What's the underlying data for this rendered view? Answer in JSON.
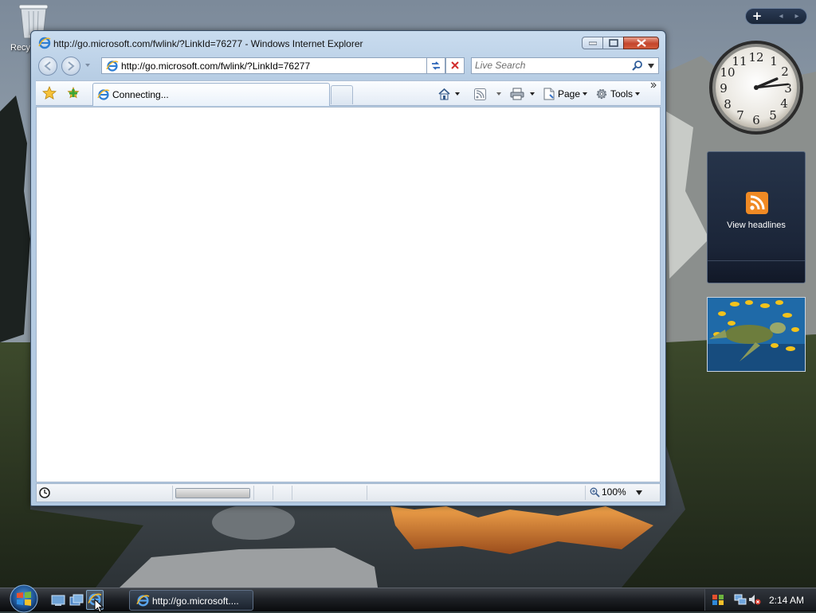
{
  "desktop": {
    "recycle_bin_label": "Recyc"
  },
  "browser": {
    "title": "http://go.microsoft.com/fwlink/?LinkId=76277 - Windows Internet Explorer",
    "address": "http://go.microsoft.com/fwlink/?LinkId=76277",
    "search_placeholder": "Live Search",
    "tab_label": "Connecting...",
    "toolbar": {
      "page_label": "Page",
      "tools_label": "Tools"
    },
    "status": {
      "progress_fraction": 1.0,
      "zoom": "100%"
    }
  },
  "sidebar": {
    "feed_label": "View headlines",
    "clock": {
      "hour": 2,
      "minute": 14
    }
  },
  "taskbar": {
    "task_label": "http://go.microsoft....",
    "time": "2:14 AM"
  }
}
